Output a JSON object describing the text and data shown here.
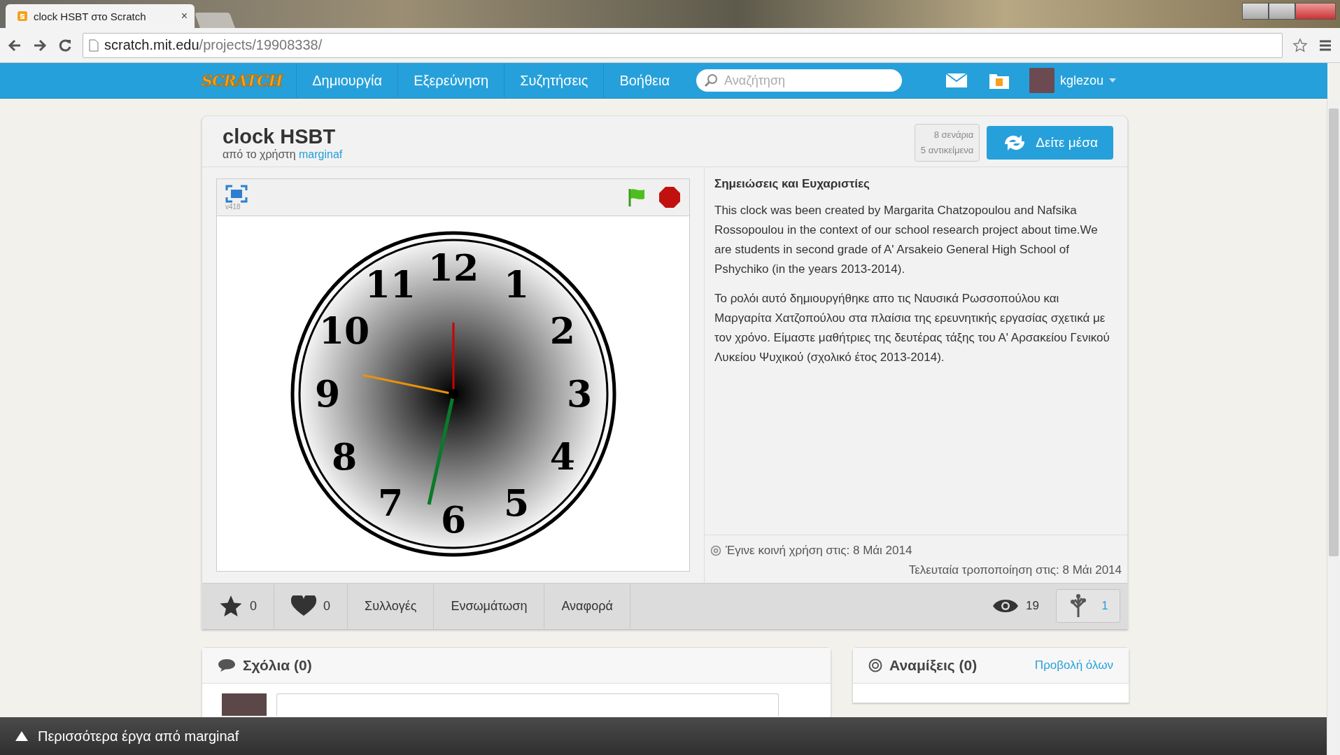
{
  "browser": {
    "tab_title": "clock HSBT στο Scratch",
    "tab_close": "×",
    "url_host": "scratch.mit.edu",
    "url_path": "/projects/19908338/"
  },
  "nav": {
    "logo": "SCRATCH",
    "items": [
      "Δημιουργία",
      "Εξερεύνηση",
      "Συζητήσεις",
      "Βοήθεια"
    ],
    "search": {
      "placeholder": "Αναζήτηση"
    },
    "username": "kglezou"
  },
  "project": {
    "title": "clock HSBT",
    "byline": "από το χρήστη",
    "author": "marginaf",
    "stats": [
      "8 σενάρια",
      "5 αντικείμενα"
    ],
    "see_inside": "Δείτε μέσα",
    "player": {
      "version": "v418",
      "clock_numerals": [
        "12",
        "11",
        "1",
        "10",
        "2",
        "9",
        "3",
        "8",
        "4",
        "7",
        "5",
        "6"
      ]
    },
    "notes": {
      "heading": "Σημειώσεις και Ευχαριστίες",
      "paragraphs": [
        "This clock was been created by Margarita Chatzopoulou and Nafsika Rossopoulou in the context of our school research project about time.We are students in second grade of A' Arsakeio General High School of Pshychiko (in the years 2013-2014).",
        "Το ρολόι αυτό δημιουργήθηκε απο τις Ναυσικά Ρωσσοπούλου και Μαργαρίτα Χατζοπούλου στα πλαίσια της ερευνητικής εργασίας σχετικά με τον χρόνο. Είμαστε μαθήτριες της δευτέρας τάξης του Α' Αρσακείου Γενικού Λυκείου Ψυχικού (σχολικό έτος 2013-2014)."
      ]
    },
    "shared": "Έγινε κοινή χρήση στις: 8 Μάι 2014",
    "modified": "Τελευταία τροποποίηση στις: 8 Μάι 2014",
    "toolbar": {
      "stars": "0",
      "loves": "0",
      "actions": [
        "Συλλογές",
        "Ενσωμάτωση",
        "Αναφορά"
      ],
      "views": "19",
      "remixes": "1"
    }
  },
  "comments": {
    "title": "Σχόλια (0)"
  },
  "remixes": {
    "title": "Αναμίξεις (0)",
    "view_all": "Προβολή όλων"
  },
  "footer_bar": {
    "text": "Περισσότερα έργα από marginaf"
  }
}
